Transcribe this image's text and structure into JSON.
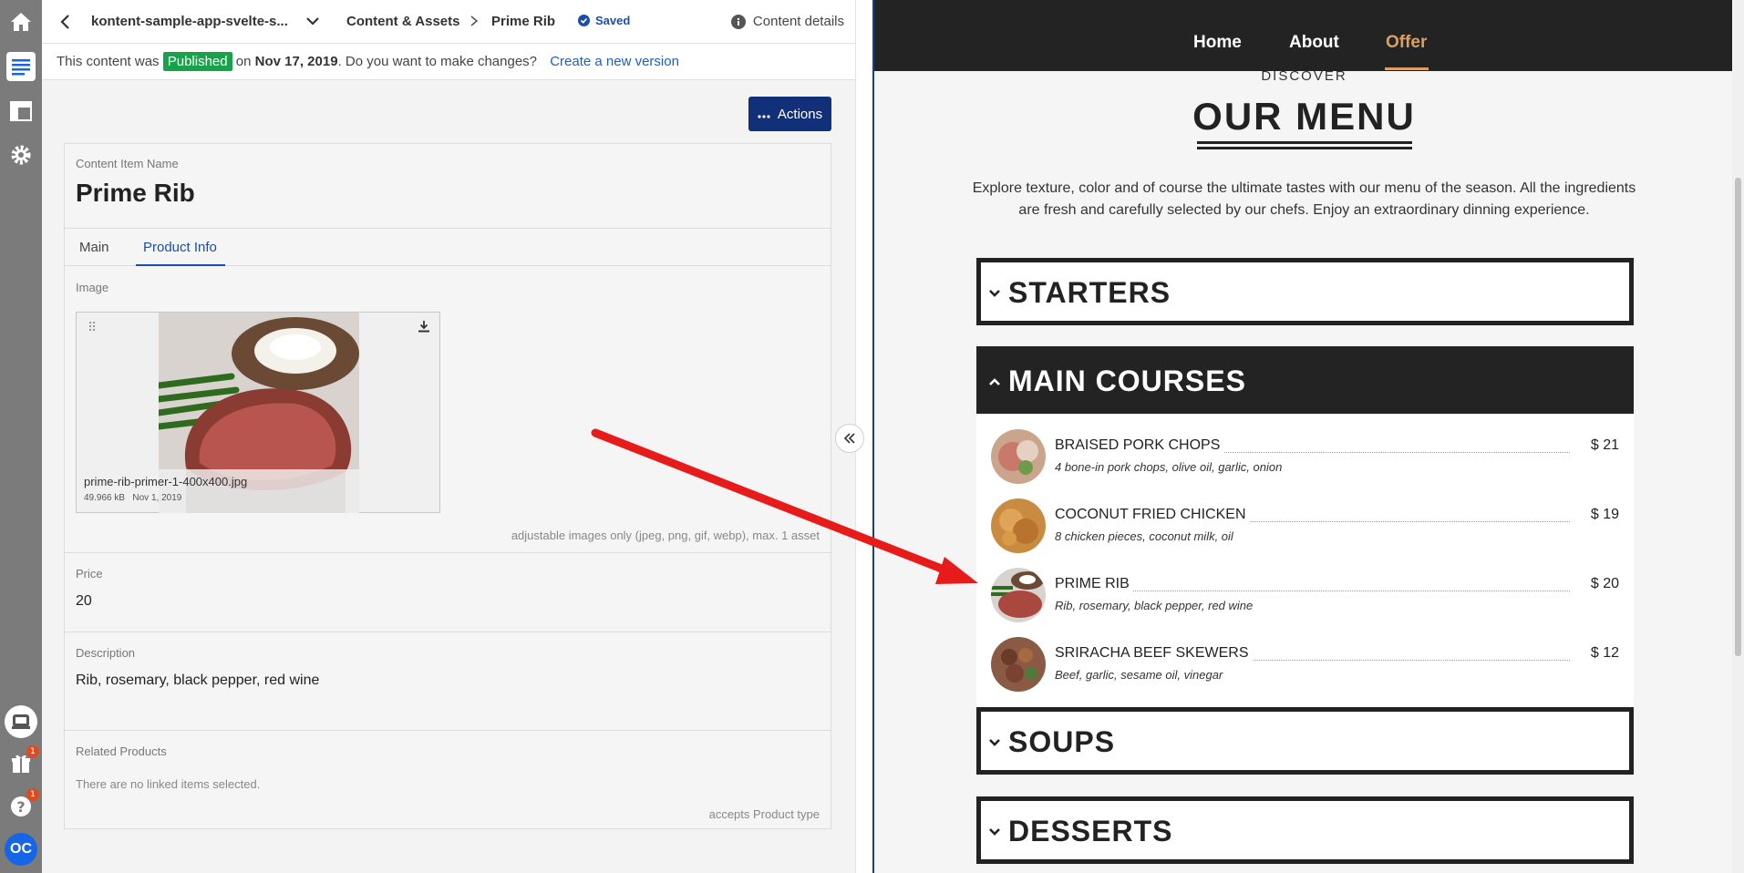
{
  "rail": {
    "icons": [
      "home-icon",
      "content-list-icon",
      "layout-icon",
      "settings-icon",
      "inbox-icon",
      "gift-icon",
      "help-icon"
    ],
    "gift_badge": "1",
    "help_badge": "1",
    "avatar_initials": "OC"
  },
  "topbar": {
    "project": "kontent-sample-app-svelte-s...",
    "crumb_section": "Content & Assets",
    "crumb_item": "Prime Rib",
    "saved_label": "Saved",
    "details_label": "Content details"
  },
  "publish_bar": {
    "prefix": "This content was",
    "status": "Published",
    "on": "on",
    "date": "Nov 17, 2019",
    "question": ". Do you want to make changes?",
    "action": "Create a new version"
  },
  "actions_label": "Actions",
  "item": {
    "name_label": "Content Item Name",
    "name": "Prime Rib",
    "tabs": [
      "Main",
      "Product Info"
    ],
    "active_tab": "Product Info",
    "image_label": "Image",
    "image_file": "prime-rib-primer-1-400x400.jpg",
    "image_size": "49.966 kB",
    "image_date": "Nov 1, 2019",
    "image_hint": "adjustable images only (jpeg, png, gif, webp), max. 1 asset",
    "price_label": "Price",
    "price": "20",
    "description_label": "Description",
    "description": "Rib, rosemary, black pepper, red wine",
    "related_label": "Related Products",
    "related_empty": "There are no linked items selected.",
    "related_hint": "accepts Product type"
  },
  "site": {
    "nav": [
      "Home",
      "About",
      "Offer"
    ],
    "nav_active": "Offer",
    "accent": "#d9a064",
    "discover": "DISCOVER",
    "title": "OUR MENU",
    "intro": "Explore texture, color and of course the ultimate tastes with our menu of the season. All the ingredients are fresh and carefully selected by our chefs. Enjoy an extraordinary dinning experience.",
    "categories": {
      "starters": "STARTERS",
      "main": "MAIN COURSES",
      "soups": "SOUPS",
      "desserts": "DESSERTS"
    },
    "dishes": [
      {
        "name": "BRAISED PORK CHOPS",
        "desc": "4 bone-in pork chops, olive oil, garlic, onion",
        "price": "$ 21"
      },
      {
        "name": "COCONUT FRIED CHICKEN",
        "desc": "8 chicken pieces, coconut milk, oil",
        "price": "$ 19"
      },
      {
        "name": "PRIME RIB",
        "desc": "Rib, rosemary, black pepper, red wine",
        "price": "$ 20"
      },
      {
        "name": "SRIRACHA BEEF SKEWERS",
        "desc": "Beef, garlic, sesame oil, vinegar",
        "price": "$ 12"
      }
    ]
  }
}
